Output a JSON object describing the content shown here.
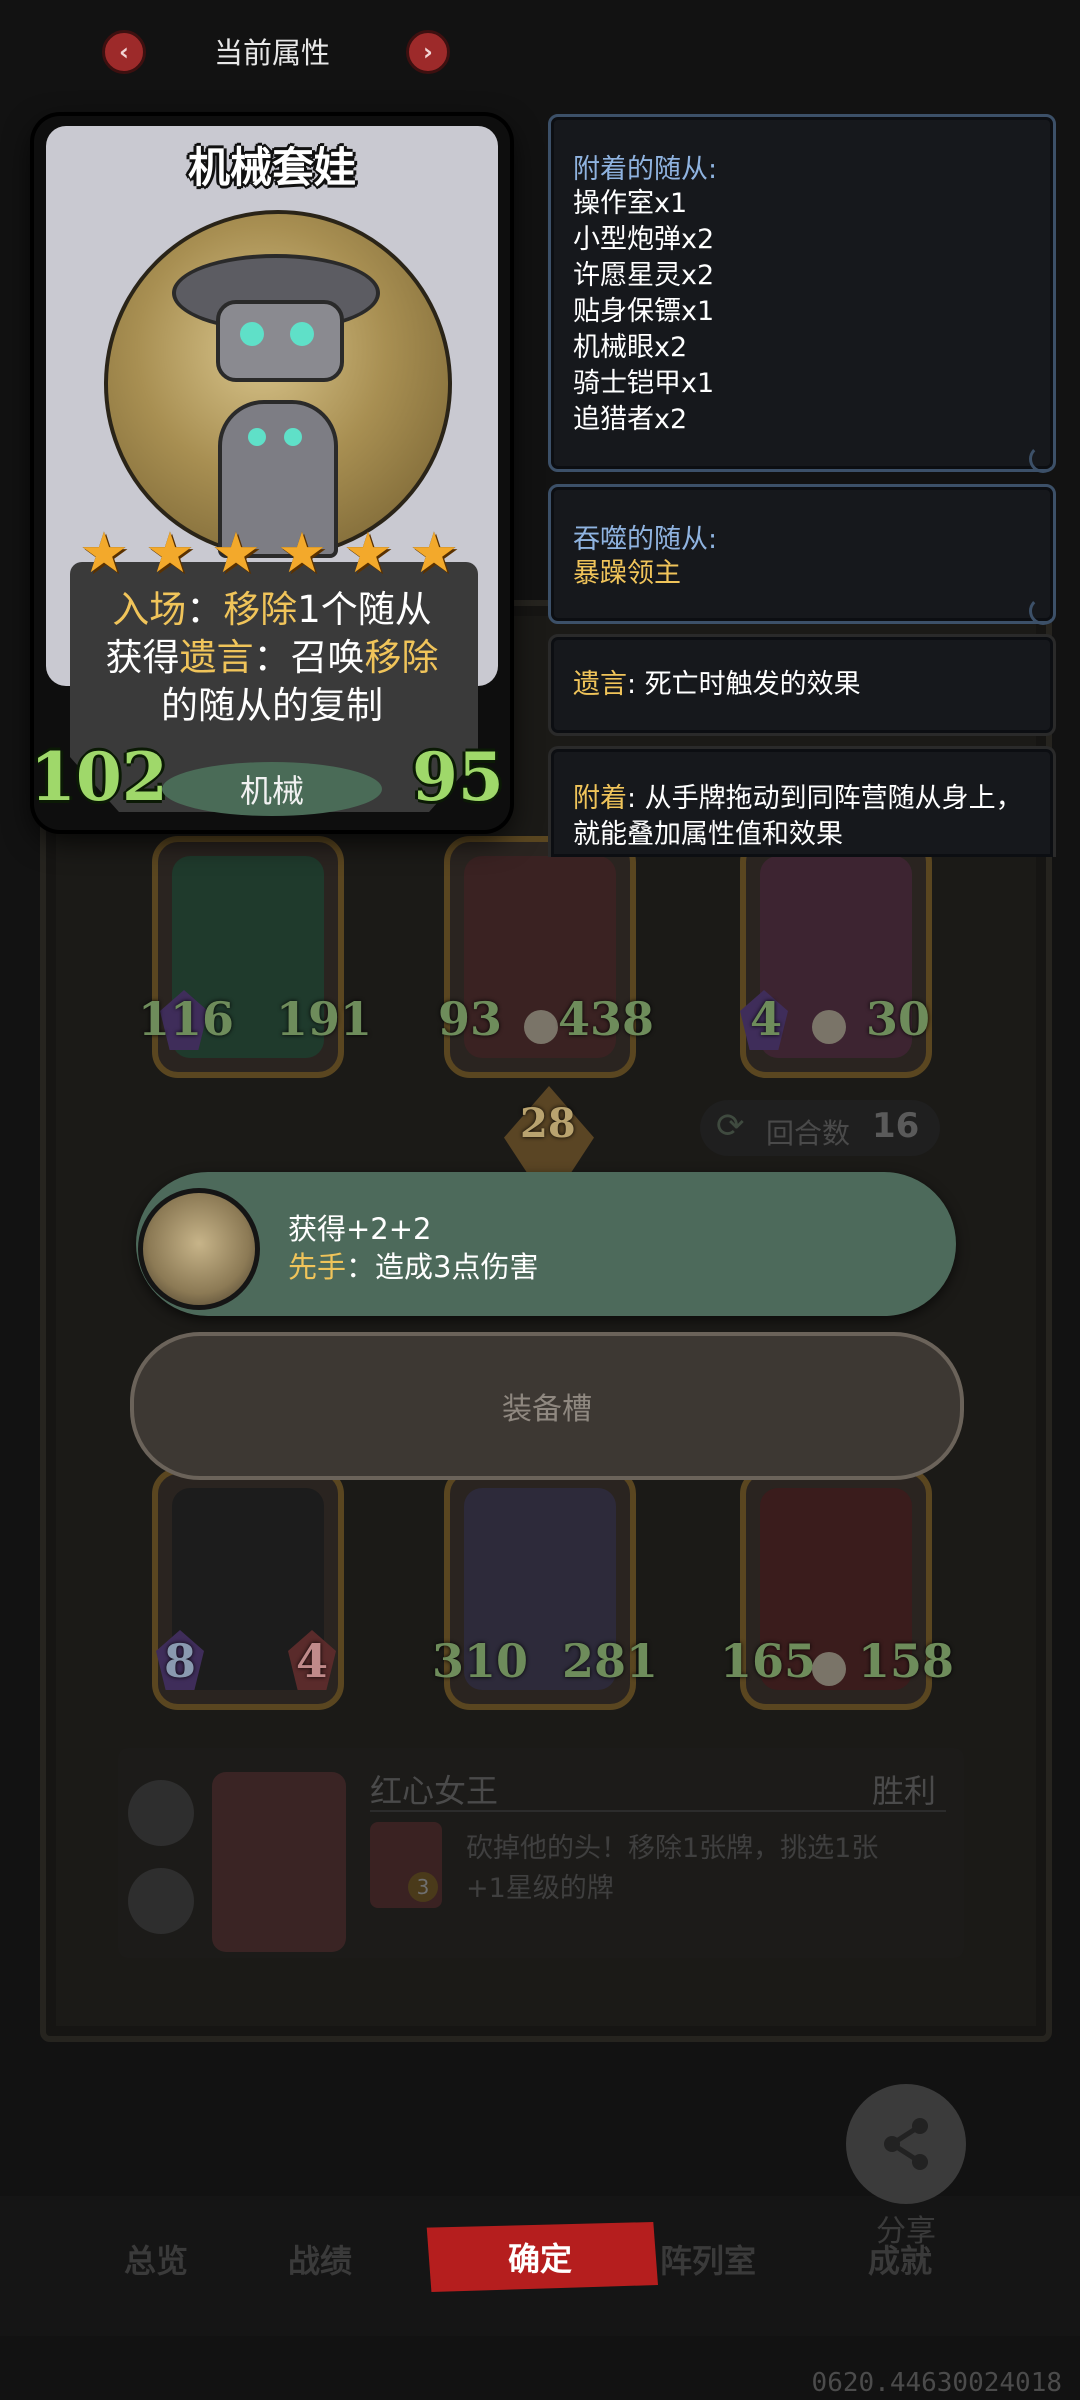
{
  "header": {
    "title": "当前属性",
    "prev_icon": "‹",
    "next_icon": "›"
  },
  "card": {
    "name": "机械套娃",
    "stars": 6,
    "star_glyph": "★",
    "desc_line1_a": "入场",
    "desc_line1_b": "：",
    "desc_line1_c": "移除",
    "desc_line1_d": "1个随从",
    "desc_line2_a": "获得",
    "desc_line2_b": "遗言",
    "desc_line2_c": "：召唤",
    "desc_line2_d": "移除",
    "desc_line3": "的随从的复制",
    "attack": "102",
    "health": "95",
    "type": "机械"
  },
  "panels": {
    "attached": {
      "title": "附着的随从:",
      "items": [
        "操作室x1",
        "小型炮弹x2",
        "许愿星灵x2",
        "贴身保镖x1",
        "机械眼x2",
        "骑士铠甲x1",
        "追猎者x2"
      ]
    },
    "devoured": {
      "title": "吞噬的随从:",
      "item": "暴躁领主"
    },
    "deathrattle": {
      "term": "遗言",
      "text": ": 死亡时触发的效果"
    },
    "attach": {
      "term": "附着",
      "text": ": 从手牌拖动到同阵营随从身上，就能叠加属性值和效果"
    }
  },
  "board": {
    "row1": [
      {
        "atk": "116",
        "hp": "191"
      },
      {
        "atk": "93",
        "hp": "438"
      },
      {
        "atk": "4",
        "hp": "30"
      }
    ],
    "tier_badge": "28",
    "turns_label": "回合数",
    "turns_value": "16",
    "row2": [
      {
        "atk": "8",
        "hp": "4"
      },
      {
        "atk": "310",
        "hp": "281"
      },
      {
        "atk": "165",
        "hp": "158"
      }
    ],
    "opponent_name": "红心女王",
    "result": "胜利",
    "hero_power_line1": "砍掉他的头！移除1张牌，挑选1张",
    "hero_power_line2": "+1星级的牌",
    "hero_power_cost": "3"
  },
  "tooltip": {
    "line1": "获得+2+2",
    "line2_term": "先手",
    "line2_text": "：造成3点伤害"
  },
  "equip_slot_label": "装备槽",
  "bottom": {
    "tabs": [
      "总览",
      "战绩",
      "阵列室",
      "成就"
    ],
    "confirm_label": "确定",
    "share_label": "分享"
  },
  "footer_code": "0620.44630024018",
  "colors": {
    "accent_red": "#b51e1e",
    "gold": "#f0c45a",
    "stat_green": "#9fd86a",
    "panel_blue": "#8fb3e0",
    "banner_green": "#4d6a5b"
  }
}
